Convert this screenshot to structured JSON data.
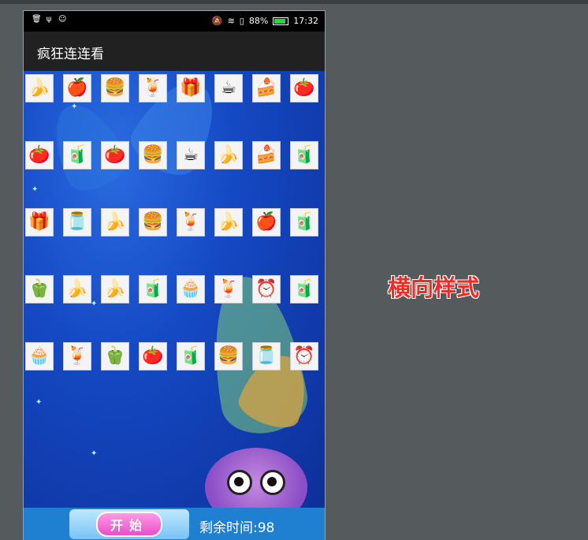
{
  "status_bar": {
    "battery": "88%",
    "time": "17:32"
  },
  "app_bar": {
    "title": "疯狂连连看"
  },
  "board": {
    "rows": [
      [
        "🍌",
        "🍎",
        "🍔",
        "🍹",
        "🎁",
        "☕",
        "🍰",
        "🍅"
      ],
      [
        "🍅",
        "🧃",
        "🍅",
        "🍔",
        "☕",
        "🍌",
        "🍰",
        "🧃"
      ],
      [
        "🎁",
        "🫙",
        "🍌",
        "🍔",
        "🍹",
        "🍌",
        "🍎",
        "🧃"
      ],
      [
        "🫑",
        "🍌",
        "🍌",
        "🧃",
        "🧁",
        "🍹",
        "⏰",
        "🧃"
      ],
      [
        "🧁",
        "🍹",
        "🫑",
        "🍅",
        "🧃",
        "🍔",
        "🫙",
        "⏰"
      ]
    ]
  },
  "bottom": {
    "start_label": "开始",
    "timer_text": "剩余时间:98"
  },
  "side_caption": "横向样式"
}
